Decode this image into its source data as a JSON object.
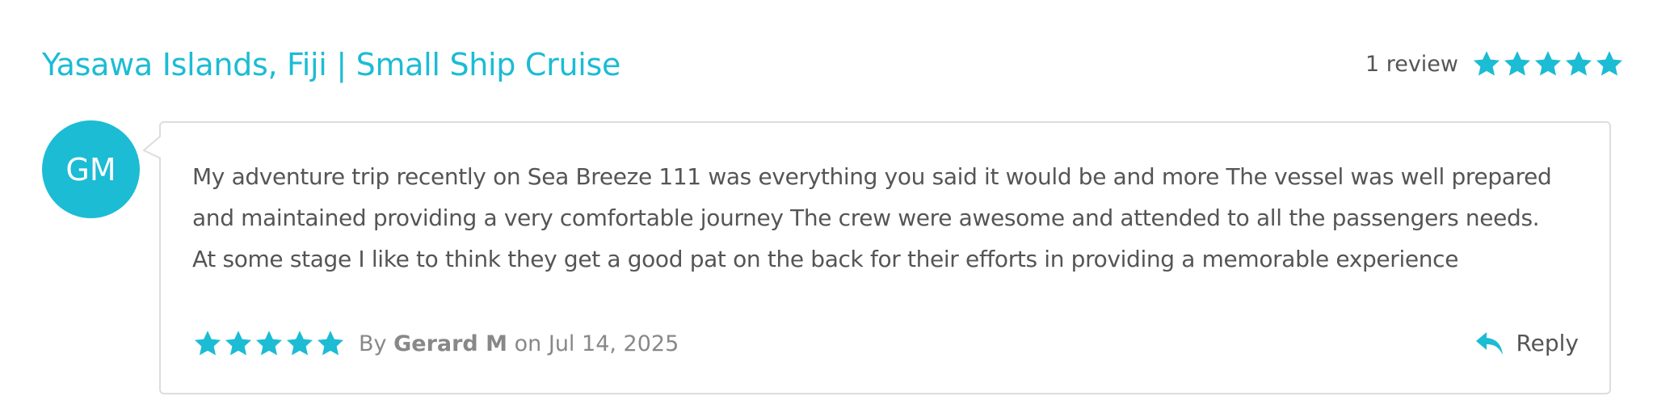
{
  "listing": {
    "title": "Yasawa Islands, Fiji | Small Ship Cruise",
    "review_count_label": "1 review",
    "rating": 5,
    "max_rating": 5
  },
  "review": {
    "avatar_initials": "GM",
    "text_lines": [
      "My adventure trip recently on Sea Breeze 111 was everything you said it would be and more The vessel was well prepared",
      "and maintained providing a very comfortable journey The crew were awesome and attended to all the passengers needs.",
      "At some stage I like to think they get a good pat on the back for their efforts in providing a memorable experience"
    ],
    "rating": 5,
    "by_label": "By",
    "author": "Gerard M",
    "on_label": "on",
    "date": "Jul 14, 2025",
    "reply_label": "Reply"
  },
  "colors": {
    "accent": "#1bbcd4",
    "text": "#555555",
    "muted": "#888888",
    "border": "#dddddd"
  },
  "icons": {
    "star": "star-icon",
    "reply": "reply-icon"
  }
}
